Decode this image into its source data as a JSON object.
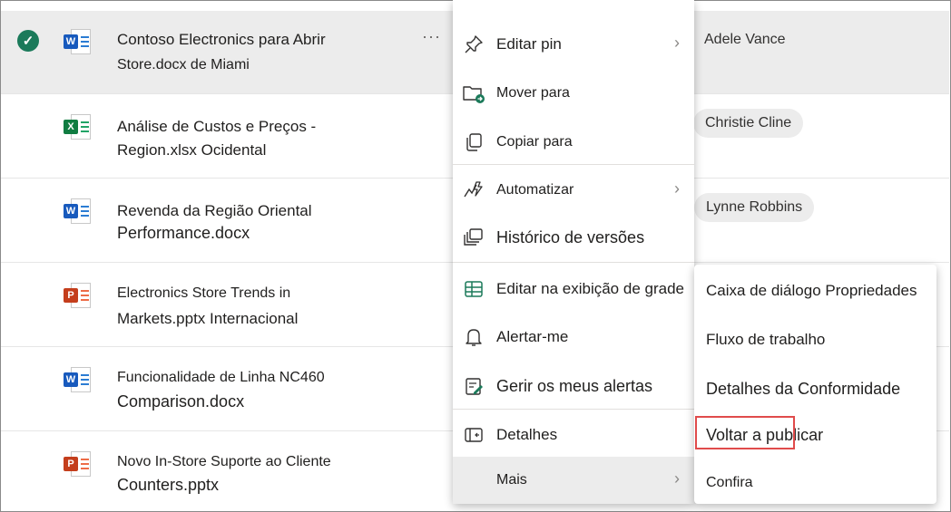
{
  "files": [
    {
      "line1": "Contoso Electronics para Abrir",
      "line2": "Store.docx de Miami",
      "type": "word",
      "person": "Adele Vance",
      "selected": true
    },
    {
      "line1": "Análise de Custos e Preços -",
      "line2": "Region.xlsx Ocidental",
      "type": "excel",
      "person": "Christie Cline"
    },
    {
      "line1": "Revenda da Região Oriental",
      "line2": "Performance.docx",
      "type": "word",
      "person": "Lynne Robbins"
    },
    {
      "line1": "Electronics Store Trends in",
      "line2": "Markets.pptx Internacional",
      "type": "ppt"
    },
    {
      "line1": "Funcionalidade de Linha NC460",
      "line2": "Comparison.docx",
      "type": "word"
    },
    {
      "line1": "Novo In-Store Suporte ao Cliente",
      "line2": "Counters.pptx",
      "type": "ppt"
    }
  ],
  "more_dots": "···",
  "check_glyph": "✓",
  "menu": {
    "items": [
      {
        "label": "Editar pin",
        "icon": "pin-icon",
        "submenu": true
      },
      {
        "label": "Mover para",
        "icon": "move-folder-icon"
      },
      {
        "label": "Copiar para",
        "icon": "copy-icon"
      },
      {
        "label": "Automatizar",
        "icon": "automate-icon",
        "submenu": true
      },
      {
        "label": "Histórico de versões",
        "icon": "version-history-icon"
      },
      {
        "label": "Editar na exibição de grade",
        "icon": "grid-icon"
      },
      {
        "label": "Alertar-me",
        "icon": "bell-icon"
      },
      {
        "label": "Gerir os meus alertas",
        "icon": "manage-alerts-icon"
      },
      {
        "label": "Detalhes",
        "icon": "details-icon"
      },
      {
        "label": "Mais",
        "submenu": true,
        "hover": true
      }
    ],
    "chevron": "›"
  },
  "submenu": {
    "items": [
      {
        "label": "Caixa de diálogo Propriedades"
      },
      {
        "label": "Fluxo de trabalho"
      },
      {
        "label": "Detalhes da Conformidade"
      },
      {
        "label": "Voltar a publicar",
        "highlighted": true
      },
      {
        "label": "Confira"
      }
    ]
  },
  "colors": {
    "accent_green": "#1b7a5a",
    "highlight_red": "#e04b4b",
    "selected_row": "#ececec"
  }
}
